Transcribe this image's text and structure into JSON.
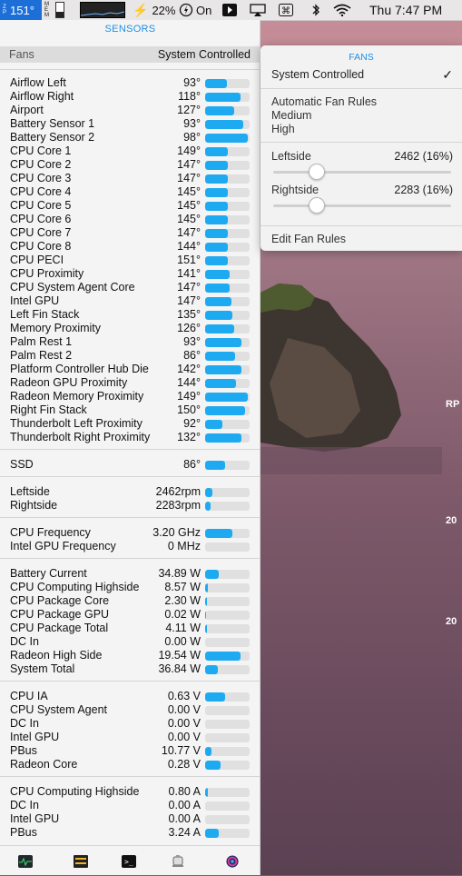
{
  "menubar": {
    "temp_label": "151°",
    "temp_side": "Z P",
    "mem_label": "M E M",
    "battery_percent": "22%",
    "power_label": "On",
    "clock": "Thu 7:47 PM"
  },
  "panel": {
    "title": "SENSORS",
    "fans_label": "Fans",
    "fans_mode": "System Controlled"
  },
  "temperatures": [
    {
      "label": "Airflow Left",
      "value": "93°",
      "fill": 0.48
    },
    {
      "label": "Airflow Right",
      "value": "118°",
      "fill": 0.8
    },
    {
      "label": "Airport",
      "value": "127°",
      "fill": 0.65
    },
    {
      "label": "Battery Sensor 1",
      "value": "93°",
      "fill": 0.85
    },
    {
      "label": "Battery Sensor 2",
      "value": "98°",
      "fill": 0.95
    },
    {
      "label": "CPU Core 1",
      "value": "149°",
      "fill": 0.5
    },
    {
      "label": "CPU Core 2",
      "value": "147°",
      "fill": 0.5
    },
    {
      "label": "CPU Core 3",
      "value": "147°",
      "fill": 0.5
    },
    {
      "label": "CPU Core 4",
      "value": "145°",
      "fill": 0.5
    },
    {
      "label": "CPU Core 5",
      "value": "145°",
      "fill": 0.5
    },
    {
      "label": "CPU Core 6",
      "value": "145°",
      "fill": 0.5
    },
    {
      "label": "CPU Core 7",
      "value": "147°",
      "fill": 0.5
    },
    {
      "label": "CPU Core 8",
      "value": "144°",
      "fill": 0.5
    },
    {
      "label": "CPU PECI",
      "value": "151°",
      "fill": 0.5
    },
    {
      "label": "CPU Proximity",
      "value": "141°",
      "fill": 0.55
    },
    {
      "label": "CPU System Agent Core",
      "value": "147°",
      "fill": 0.55
    },
    {
      "label": "Intel GPU",
      "value": "147°",
      "fill": 0.6
    },
    {
      "label": "Left Fin Stack",
      "value": "135°",
      "fill": 0.62
    },
    {
      "label": "Memory Proximity",
      "value": "126°",
      "fill": 0.65
    },
    {
      "label": "Palm Rest 1",
      "value": "93°",
      "fill": 0.82
    },
    {
      "label": "Palm Rest 2",
      "value": "86°",
      "fill": 0.68
    },
    {
      "label": "Platform Controller Hub Die",
      "value": "142°",
      "fill": 0.82
    },
    {
      "label": "Radeon GPU Proximity",
      "value": "144°",
      "fill": 0.7
    },
    {
      "label": "Radeon Memory Proximity",
      "value": "149°",
      "fill": 0.95
    },
    {
      "label": "Right Fin Stack",
      "value": "150°",
      "fill": 0.9
    },
    {
      "label": "Thunderbolt Left Proximity",
      "value": "92°",
      "fill": 0.38
    },
    {
      "label": "Thunderbolt Right Proximity",
      "value": "132°",
      "fill": 0.82
    }
  ],
  "ssd": [
    {
      "label": "SSD",
      "value": "86°",
      "fill": 0.45
    }
  ],
  "fans": [
    {
      "label": "Leftside",
      "value": "2462rpm",
      "fill": 0.16
    },
    {
      "label": "Rightside",
      "value": "2283rpm",
      "fill": 0.12
    }
  ],
  "frequencies": [
    {
      "label": "CPU Frequency",
      "value": "3.20 GHz",
      "fill": 0.62
    },
    {
      "label": "Intel GPU Frequency",
      "value": "0 MHz",
      "fill": 0.0
    }
  ],
  "power": [
    {
      "label": "Battery Current",
      "value": "34.89 W",
      "fill": 0.3
    },
    {
      "label": "CPU Computing Highside",
      "value": "8.57 W",
      "fill": 0.07
    },
    {
      "label": "CPU Package Core",
      "value": "2.30 W",
      "fill": 0.05
    },
    {
      "label": "CPU Package GPU",
      "value": "0.02 W",
      "fill": 0.03
    },
    {
      "label": "CPU Package Total",
      "value": "4.11 W",
      "fill": 0.04
    },
    {
      "label": "DC In",
      "value": "0.00 W",
      "fill": 0.0
    },
    {
      "label": "Radeon High Side",
      "value": "19.54 W",
      "fill": 0.8
    },
    {
      "label": "System Total",
      "value": "36.84 W",
      "fill": 0.28
    }
  ],
  "voltages": [
    {
      "label": "CPU IA",
      "value": "0.63 V",
      "fill": 0.45
    },
    {
      "label": "CPU System Agent",
      "value": "0.00 V",
      "fill": 0.0
    },
    {
      "label": "DC In",
      "value": "0.00 V",
      "fill": 0.0
    },
    {
      "label": "Intel GPU",
      "value": "0.00 V",
      "fill": 0.0
    },
    {
      "label": "PBus",
      "value": "10.77 V",
      "fill": 0.14
    },
    {
      "label": "Radeon Core",
      "value": "0.28 V",
      "fill": 0.35
    }
  ],
  "currents": [
    {
      "label": "CPU Computing Highside",
      "value": "0.80 A",
      "fill": 0.06
    },
    {
      "label": "DC In",
      "value": "0.00 A",
      "fill": 0.0
    },
    {
      "label": "Intel GPU",
      "value": "0.00 A",
      "fill": 0.0
    },
    {
      "label": "PBus",
      "value": "3.24 A",
      "fill": 0.3
    }
  ],
  "popup": {
    "title": "FANS",
    "system_controlled": "System Controlled",
    "check": "✓",
    "rules_label": "Automatic Fan Rules",
    "rule_medium": "Medium",
    "rule_high": "High",
    "left_label": "Leftside",
    "left_value": "2462 (16%)",
    "left_level": 0.16,
    "right_label": "Rightside",
    "right_value": "2283 (16%)",
    "right_level": 0.16,
    "edit_label": "Edit Fan Rules"
  },
  "desktop_side": [
    "RP",
    "20",
    "20"
  ],
  "colors": {
    "accent": "#1e8fe6",
    "bar": "#1eaaf1",
    "menubar_temp": "#1d6fd8"
  },
  "icons": [
    "activity-monitor-icon",
    "console-icon",
    "terminal-icon",
    "system-info-icon",
    "istat-icon"
  ]
}
